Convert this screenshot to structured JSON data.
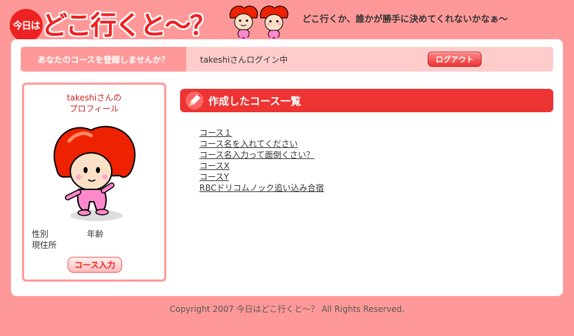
{
  "header": {
    "badge": "今日は",
    "logo": "どこ行くと〜？",
    "tagline": "どこ行くか、誰かが勝手に決めてくれないかなぁ〜"
  },
  "topbar": {
    "register_prompt": "あなたのコースを登録しませんか？",
    "login_status": "takeshiさんログイン中",
    "logout_label": "ログアウト"
  },
  "profile": {
    "title_line1": "takeshiさんの",
    "title_line2": "プロフィール",
    "gender_label": "性別",
    "age_label": "年齢",
    "residence_label": "現住所",
    "course_button": "コース入力"
  },
  "courses": {
    "title": "作成したコース一覧",
    "items": [
      "コース１",
      "コース名を入れてください",
      "コース名入力って面倒くさい？",
      "コースX",
      "コースY",
      "RBCドリコムノック追い込み合宿"
    ]
  },
  "footer": {
    "copyright": "Copyright 2007 今日はどこ行くと〜？ All Rights Reserved."
  },
  "colors": {
    "background": "#ff9999",
    "accent": "#ee3333",
    "bar": "#ffcccc",
    "panel": "#ffffff"
  }
}
